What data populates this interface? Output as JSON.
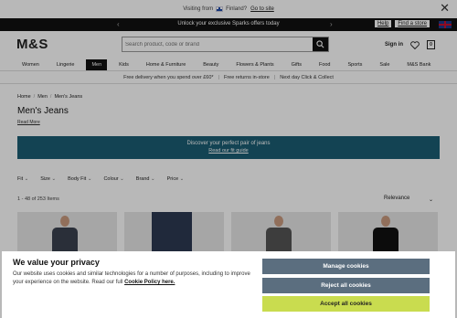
{
  "topbar": {
    "visiting_from": "Visiting from",
    "country": "Finland?",
    "goto_site": "Go to site",
    "close_icon": "close-icon"
  },
  "promo": {
    "message": "Unlock your exclusive Sparks offers today",
    "help": "Help",
    "find_store": "Find a store",
    "prev_arrow": "‹",
    "next_arrow": "›"
  },
  "header": {
    "logo": "M&S",
    "search_placeholder": "Search product, code or brand",
    "sign_in": "Sign in",
    "bag_count": "0"
  },
  "nav": {
    "items": [
      "Women",
      "Lingerie",
      "Men",
      "Kids",
      "Home & Furniture",
      "Beauty",
      "Flowers & Plants",
      "Gifts",
      "Food",
      "Sports",
      "Sale",
      "M&S Bank"
    ],
    "active": "Men"
  },
  "delivery": {
    "items": [
      "Free delivery when you spend over £60*",
      "Free returns in-store",
      "Next day Click & Collect"
    ]
  },
  "breadcrumb": [
    "Home",
    "Men",
    "Men's Jeans"
  ],
  "page": {
    "title": "Men's Jeans",
    "read_more": "Read More"
  },
  "fit_banner": {
    "title": "Discover your perfect pair of jeans",
    "link": "Read our fit guide"
  },
  "filters": [
    "Fit",
    "Size",
    "Body Fit",
    "Colour",
    "Brand",
    "Price"
  ],
  "results": {
    "count": "1 - 48 of 253 Items",
    "sort": "Relevance"
  },
  "cookie": {
    "title": "We value your privacy",
    "text": "Our website uses cookies and similar technologies for a number of purposes, including to improve your experience on the website. Read our full",
    "policy_link": "Cookie Policy here.",
    "manage": "Manage cookies",
    "reject": "Reject all cookies",
    "accept": "Accept all cookies"
  },
  "colors": {
    "banner": "#1b5e74",
    "manage_btn": "#5b6e7f",
    "accept_btn": "#c9dc4f"
  }
}
